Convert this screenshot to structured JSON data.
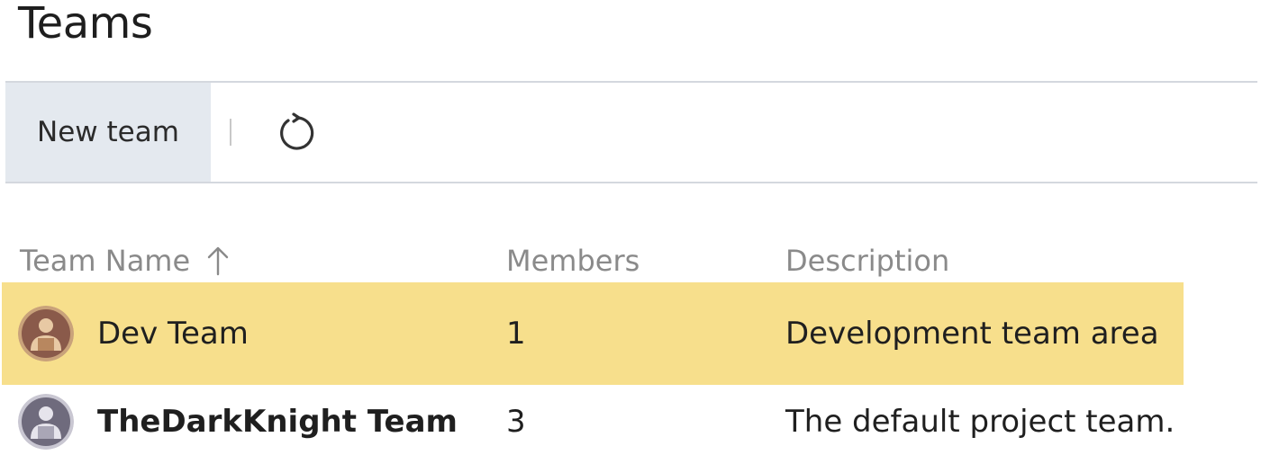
{
  "page": {
    "title": "Teams"
  },
  "toolbar": {
    "new_team_label": "New team",
    "refresh_icon": "refresh-icon"
  },
  "table": {
    "columns": {
      "name": "Team Name",
      "members": "Members",
      "description": "Description"
    },
    "sort": {
      "column": "Team Name",
      "direction": "ascending",
      "icon": "arrow-up-icon"
    },
    "rows": [
      {
        "name": "Dev Team",
        "members": "1",
        "description": "Development team area",
        "selected": true,
        "avatar_color": "#8a5a4a",
        "avatar_bg": "#c9a27a"
      },
      {
        "name": "TheDarkKnight Team",
        "members": "3",
        "description": "The default project team.",
        "selected": false,
        "avatar_color": "#6f6b7d",
        "avatar_bg": "#c9c7d2"
      }
    ]
  },
  "colors": {
    "selected_row": "#f7df8c",
    "toolbar_button_bg": "#e4e9ef",
    "header_text": "#8a8a8a"
  }
}
